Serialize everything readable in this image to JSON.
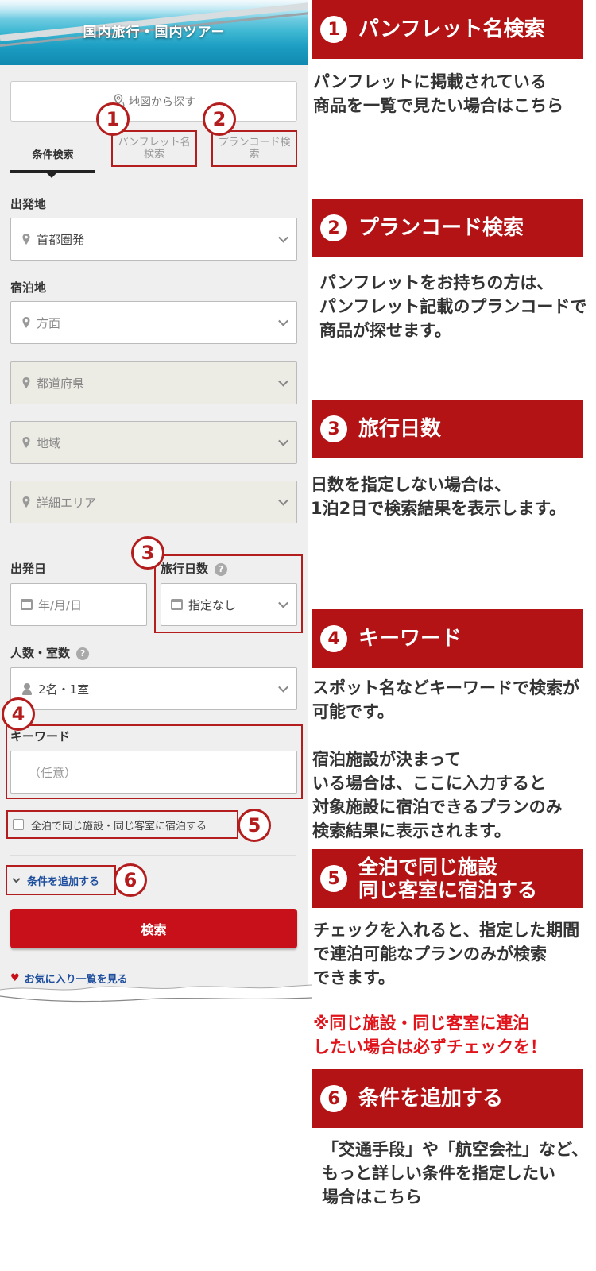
{
  "hero": {
    "title": "国内旅行・国内ツアー"
  },
  "search": {
    "map_button": "地図から探す",
    "tabs": [
      {
        "label": "条件検索"
      },
      {
        "label": "パンフレット名\n検索"
      },
      {
        "label": "プランコード検\n索"
      }
    ],
    "departure": {
      "label": "出発地",
      "value": "首都圏発"
    },
    "stay": {
      "label": "宿泊地",
      "area": "方面",
      "prefecture": "都道府県",
      "region": "地域",
      "detail_area": "詳細エリア"
    },
    "departure_date": {
      "label": "出発日",
      "placeholder": "年/月/日"
    },
    "trip_days": {
      "label": "旅行日数",
      "help": "?",
      "value": "指定なし"
    },
    "people_rooms": {
      "label": "人数・室数",
      "help": "?",
      "value": "2名・1室"
    },
    "keyword": {
      "label": "キーワード",
      "placeholder": "（任意）"
    },
    "same_room_checkbox": "全泊で同じ施設・同じ客室に宿泊する",
    "add_conditions": "条件を追加する",
    "search_button": "検索",
    "favorites_link": "お気に入り一覧を見る"
  },
  "markers": [
    "1",
    "2",
    "3",
    "4",
    "5",
    "6"
  ],
  "annotations": [
    {
      "number": "1",
      "title": "パンフレット名検索",
      "description": "パンフレットに掲載されている\n商品を一覧で見たい場合はこちら"
    },
    {
      "number": "2",
      "title": "プランコード検索",
      "description": "パンフレットをお持ちの方は、\nパンフレット記載のプランコードで\n商品が探せます。"
    },
    {
      "number": "3",
      "title": "旅行日数",
      "description": "日数を指定しない場合は、\n1泊2日で検索結果を表示します。"
    },
    {
      "number": "4",
      "title": "キーワード",
      "description": "スポット名などキーワードで検索が\n可能です。\n\n宿泊施設が決まって\nいる場合は、ここに入力すると\n対象施設に宿泊できるプランのみ\n検索結果に表示されます。"
    },
    {
      "number": "5",
      "title": "全泊で同じ施設\n同じ客室に宿泊する",
      "description": "チェックを入れると、指定した期間\nで連泊可能なプランのみが検索\nできます。",
      "note": "※同じ施設・同じ客室に連泊\nしたい場合は必ずチェックを！"
    },
    {
      "number": "6",
      "title": "条件を追加する",
      "description": "「交通手段」や「航空会社」など、\nもっと詳しい条件を指定したい\n場合はこちら"
    }
  ],
  "colors": {
    "accent_red": "#b31315",
    "button_red": "#c8101b",
    "link_blue": "#1f4f9e",
    "note_red": "#e0141a"
  },
  "icons": [
    "map-pin-icon",
    "location-pin-icon",
    "calendar-icon",
    "person-icon",
    "chevron-down-icon",
    "heart-icon",
    "help-icon",
    "checkbox"
  ]
}
